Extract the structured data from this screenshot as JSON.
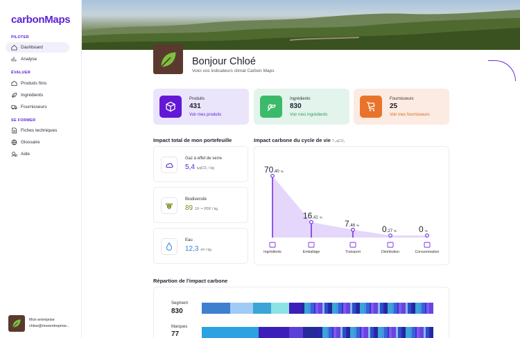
{
  "app": {
    "logo": "carbonMaps"
  },
  "sidebar": {
    "sections": [
      {
        "title": "PILOTER",
        "items": [
          {
            "label": "Dashboard",
            "icon": "home-icon",
            "active": true
          },
          {
            "label": "Analyse",
            "icon": "chart-icon",
            "active": false
          }
        ]
      },
      {
        "title": "ÉVALUER",
        "items": [
          {
            "label": "Produits finis",
            "icon": "box-icon",
            "active": false
          },
          {
            "label": "Ingrédients",
            "icon": "leaf-icon",
            "active": false
          },
          {
            "label": "Fournisseurs",
            "icon": "truck-icon",
            "active": false
          }
        ]
      },
      {
        "title": "SE FORMER",
        "items": [
          {
            "label": "Fiches techniques",
            "icon": "document-icon",
            "active": false
          },
          {
            "label": "Glossaire",
            "icon": "globe-icon",
            "active": false
          },
          {
            "label": "Aide",
            "icon": "help-icon",
            "active": false
          }
        ]
      }
    ],
    "profile": {
      "name": "Mon entreprise",
      "email": "chloe@monentreprise..."
    }
  },
  "header": {
    "greeting": "Bonjour Chloé",
    "subtitle": "Voici vos indicateurs climat Carbon Maps"
  },
  "stats": [
    {
      "label": "Produits",
      "value": "431",
      "link": "Voir mes produits",
      "bg": "#eae5fb",
      "icon_bg": "#6318d6",
      "link_color": "#5b21d6",
      "icon": "cube-icon"
    },
    {
      "label": "Ingrédients",
      "value": "830",
      "link": "Voir mes ingrédients",
      "bg": "#e3f4ec",
      "icon_bg": "#3cba6a",
      "link_color": "#2e9b55",
      "icon": "sprout-icon"
    },
    {
      "label": "Fournisseurs",
      "value": "25",
      "link": "Voir mes fournisseurs",
      "bg": "#fcebe2",
      "icon_bg": "#e8742c",
      "link_color": "#d9661c",
      "icon": "cart-icon"
    }
  ],
  "portfolio": {
    "title": "Impact total de mon portefeuille",
    "items": [
      {
        "label": "Gaz à effet de serre",
        "value": "5,4",
        "unit": "tₑqCO₂ / kg",
        "color": "#5b21d6",
        "icon": "cloud-icon"
      },
      {
        "label": "Biodiversité",
        "value": "89",
        "unit": "10⁻¹⁴ PDF / kg",
        "color": "#7a8a1a",
        "icon": "bee-icon"
      },
      {
        "label": "Eau",
        "value": "12,3",
        "unit": "m³ / kg",
        "color": "#2a7fd6",
        "icon": "drop-icon"
      }
    ]
  },
  "lifecycle": {
    "title": "Impact carbone du cycle de vie",
    "title_unit": "T ₑqCO₂",
    "unit": "%"
  },
  "chart_data": {
    "type": "line",
    "categories": [
      "Ingrédients",
      "Emballage",
      "Transport",
      "Distribution",
      "Consommation"
    ],
    "series": [
      {
        "values": [
          70.4,
          16.41,
          7.46,
          0.27,
          0
        ]
      }
    ],
    "value_labels": [
      {
        "int": "70",
        "dec": ",40"
      },
      {
        "int": "16",
        "dec": ",41"
      },
      {
        "int": "7",
        "dec": ",46"
      },
      {
        "int": "0",
        "dec": ",27"
      },
      {
        "int": "0",
        "dec": ""
      }
    ],
    "ylim": [
      0,
      80
    ],
    "color": "#7b2ee0"
  },
  "repartition": {
    "title": "Répartion de l'impact carbone",
    "rows": [
      {
        "label": "Segment",
        "value": "830"
      },
      {
        "label": "Marques",
        "value": "77"
      }
    ]
  }
}
